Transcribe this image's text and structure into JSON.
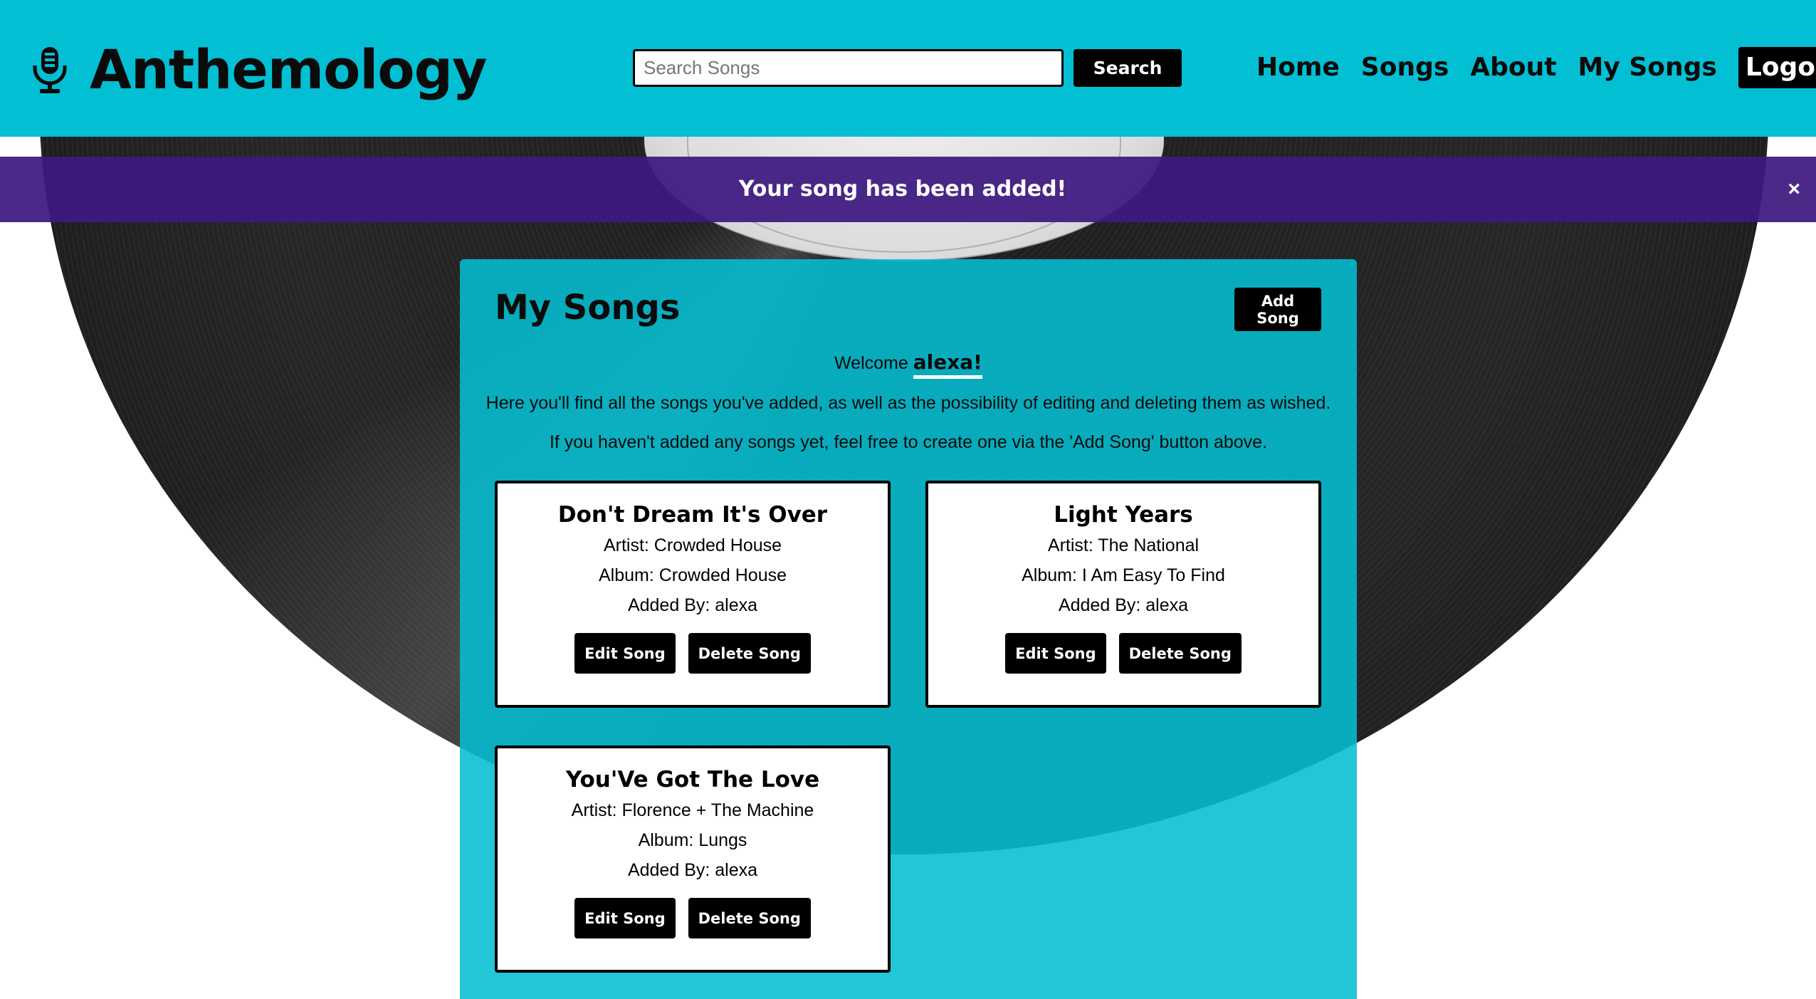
{
  "header": {
    "brand": "Anthemology",
    "logo_icon": "microphone-icon",
    "search": {
      "placeholder": "Search Songs",
      "value": "",
      "button_label": "Search"
    },
    "nav": [
      {
        "id": "home",
        "label": "Home"
      },
      {
        "id": "songs",
        "label": "Songs"
      },
      {
        "id": "about",
        "label": "About"
      },
      {
        "id": "my-songs",
        "label": "My Songs"
      },
      {
        "id": "logout",
        "label": "Logout"
      }
    ]
  },
  "flash": {
    "message": "Your song has been added!",
    "close_label": "×"
  },
  "main": {
    "title": "My Songs",
    "add_button_label": "Add Song",
    "welcome_prefix": "Welcome",
    "username": "alexa!",
    "intro_line_1": "Here you'll find all the songs you've added, as well as the possibility of editing and deleting them as wished.",
    "intro_line_2": "If you haven't added any songs yet, feel free to create one via the 'Add Song' button above.",
    "songs": [
      {
        "title": "Don't Dream It's Over",
        "artist": "Artist: Crowded House",
        "album": "Album: Crowded House",
        "added_by": "Added By: alexa",
        "edit_label": "Edit Song",
        "delete_label": "Delete Song"
      },
      {
        "title": "Light Years",
        "artist": "Artist: The National",
        "album": "Album: I Am Easy To Find",
        "added_by": "Added By: alexa",
        "edit_label": "Edit Song",
        "delete_label": "Delete Song"
      },
      {
        "title": "You'Ve Got The Love",
        "artist": "Artist: Florence + The Machine",
        "album": "Album: Lungs",
        "added_by": "Added By: alexa",
        "edit_label": "Edit Song",
        "delete_label": "Delete Song"
      }
    ]
  },
  "colors": {
    "header_bg": "#03bfd3",
    "flash_bg": "#3c1980",
    "panel_bg": "#03bed2",
    "button_bg": "#000000"
  }
}
